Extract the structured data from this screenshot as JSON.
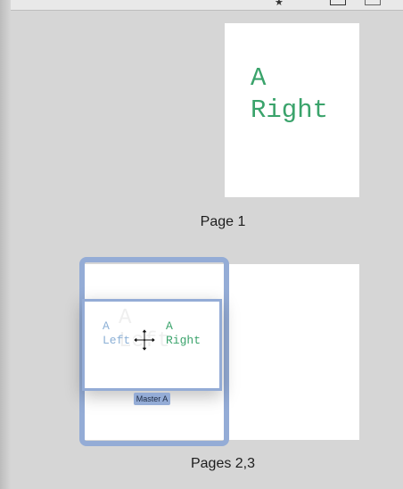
{
  "page1": {
    "master_prefix": "A",
    "label": "Right",
    "caption": "Page 1"
  },
  "spread": {
    "caption": "Pages 2,3",
    "drag_preview": {
      "left_prefix": "A",
      "left_label": "Left",
      "right_prefix": "A",
      "right_label": "Right",
      "ghost_prefix": "A",
      "ghost_label": "Left"
    },
    "badge": "Master A"
  },
  "colors": {
    "canvas": "#d6d6d6",
    "selection": "#94acd6",
    "right_master_text": "#3aa36b",
    "left_master_text": "#8cb0d6"
  },
  "toolbar_icons": [
    "star-icon",
    "square-icon",
    "square-icon"
  ]
}
